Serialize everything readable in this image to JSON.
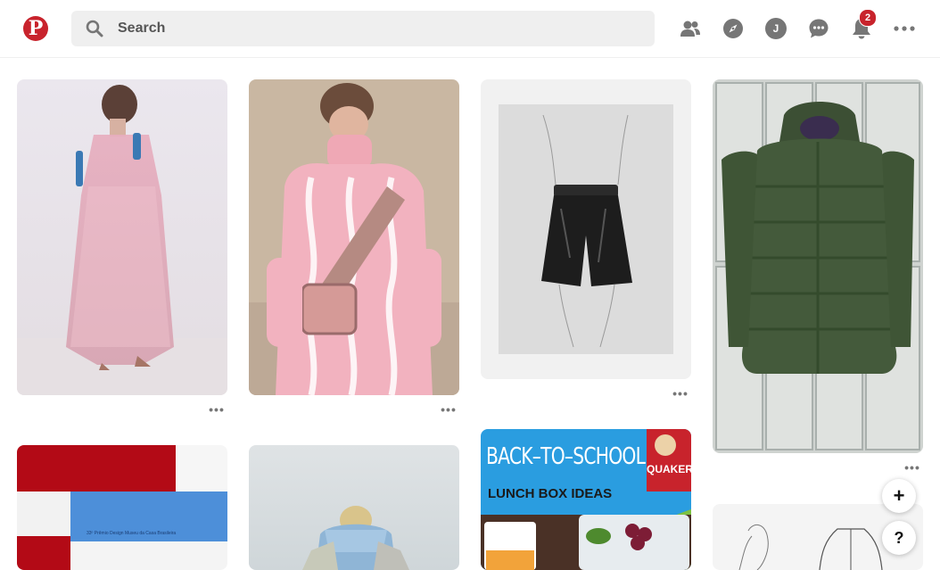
{
  "header": {
    "logo_text": "P",
    "search_placeholder": "Search",
    "avatar_initial": "J",
    "notifications_count": "2",
    "brand_color": "#c8232c"
  },
  "pins": {
    "more_label": "•••",
    "lunchbox_title_1": "BACK–TO–SCHOOL",
    "lunchbox_title_2": "LUNCH BOX IDEAS",
    "lunchbox_brand": "QUAKER",
    "poster_caption": "33º Prêmio Design Museu da Casa Brasileira"
  },
  "fab": {
    "add_label": "+",
    "help_label": "?"
  },
  "icons": [
    "search-icon",
    "people-icon",
    "compass-icon",
    "chat-icon",
    "bell-icon",
    "more-icon"
  ]
}
